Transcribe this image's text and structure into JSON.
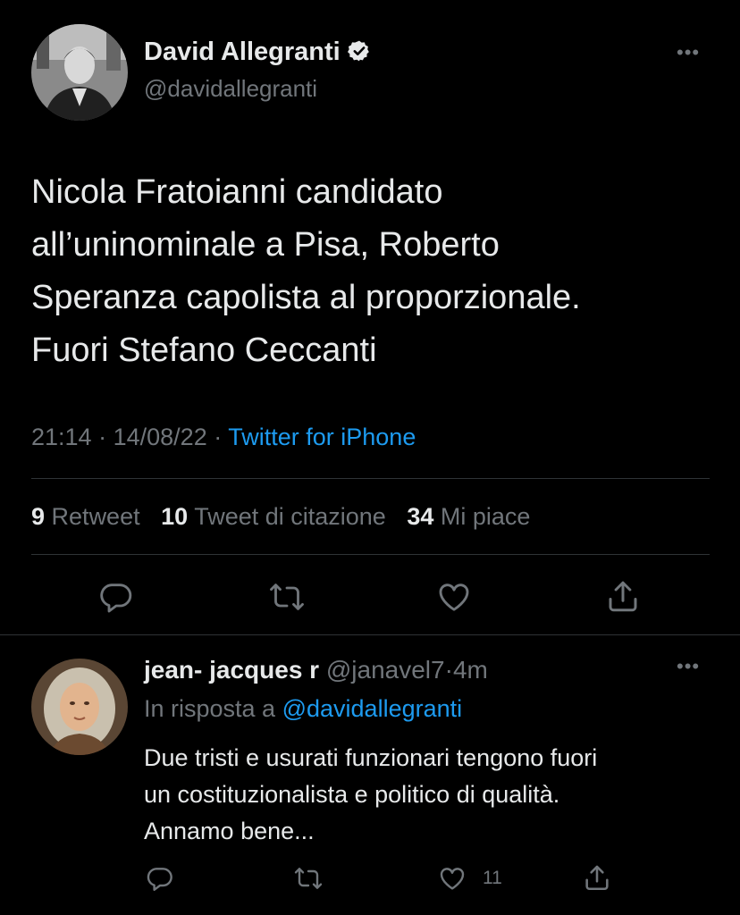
{
  "tweet": {
    "author": {
      "name": "David Allegranti",
      "handle": "@davidallegranti",
      "verified_icon": "verified-badge-icon"
    },
    "text_lines": [
      "Nicola Fratoianni candidato",
      "all’uninominale a Pisa, Roberto",
      "Speranza capolista al proporzionale.",
      "Fuori Stefano Ceccanti"
    ],
    "time": "21:14",
    "date": "14/08/22",
    "separator": "·",
    "source": "Twitter for iPhone",
    "stats": {
      "retweets_count": "9",
      "retweets_label": "Retweet",
      "quotes_count": "10",
      "quotes_label": "Tweet di citazione",
      "likes_count": "34",
      "likes_label": "Mi piace"
    },
    "more_label": "•••"
  },
  "reply": {
    "name": "jean- jacques r",
    "handle": "@janavel7",
    "separator": "·",
    "time": "4m",
    "replying_to_label": "In risposta a",
    "replying_to_handle": "@davidallegranti",
    "text_lines": [
      "Due tristi e usurati funzionari tengono fuori",
      "un costituzionalista e politico di qualità.",
      "Annamo bene..."
    ],
    "like_count": "11",
    "more_label": "•••"
  },
  "colors": {
    "background": "#000000",
    "text": "#e7e9ea",
    "secondary": "#71767b",
    "link": "#1d9bf0",
    "divider": "#2f3336"
  }
}
